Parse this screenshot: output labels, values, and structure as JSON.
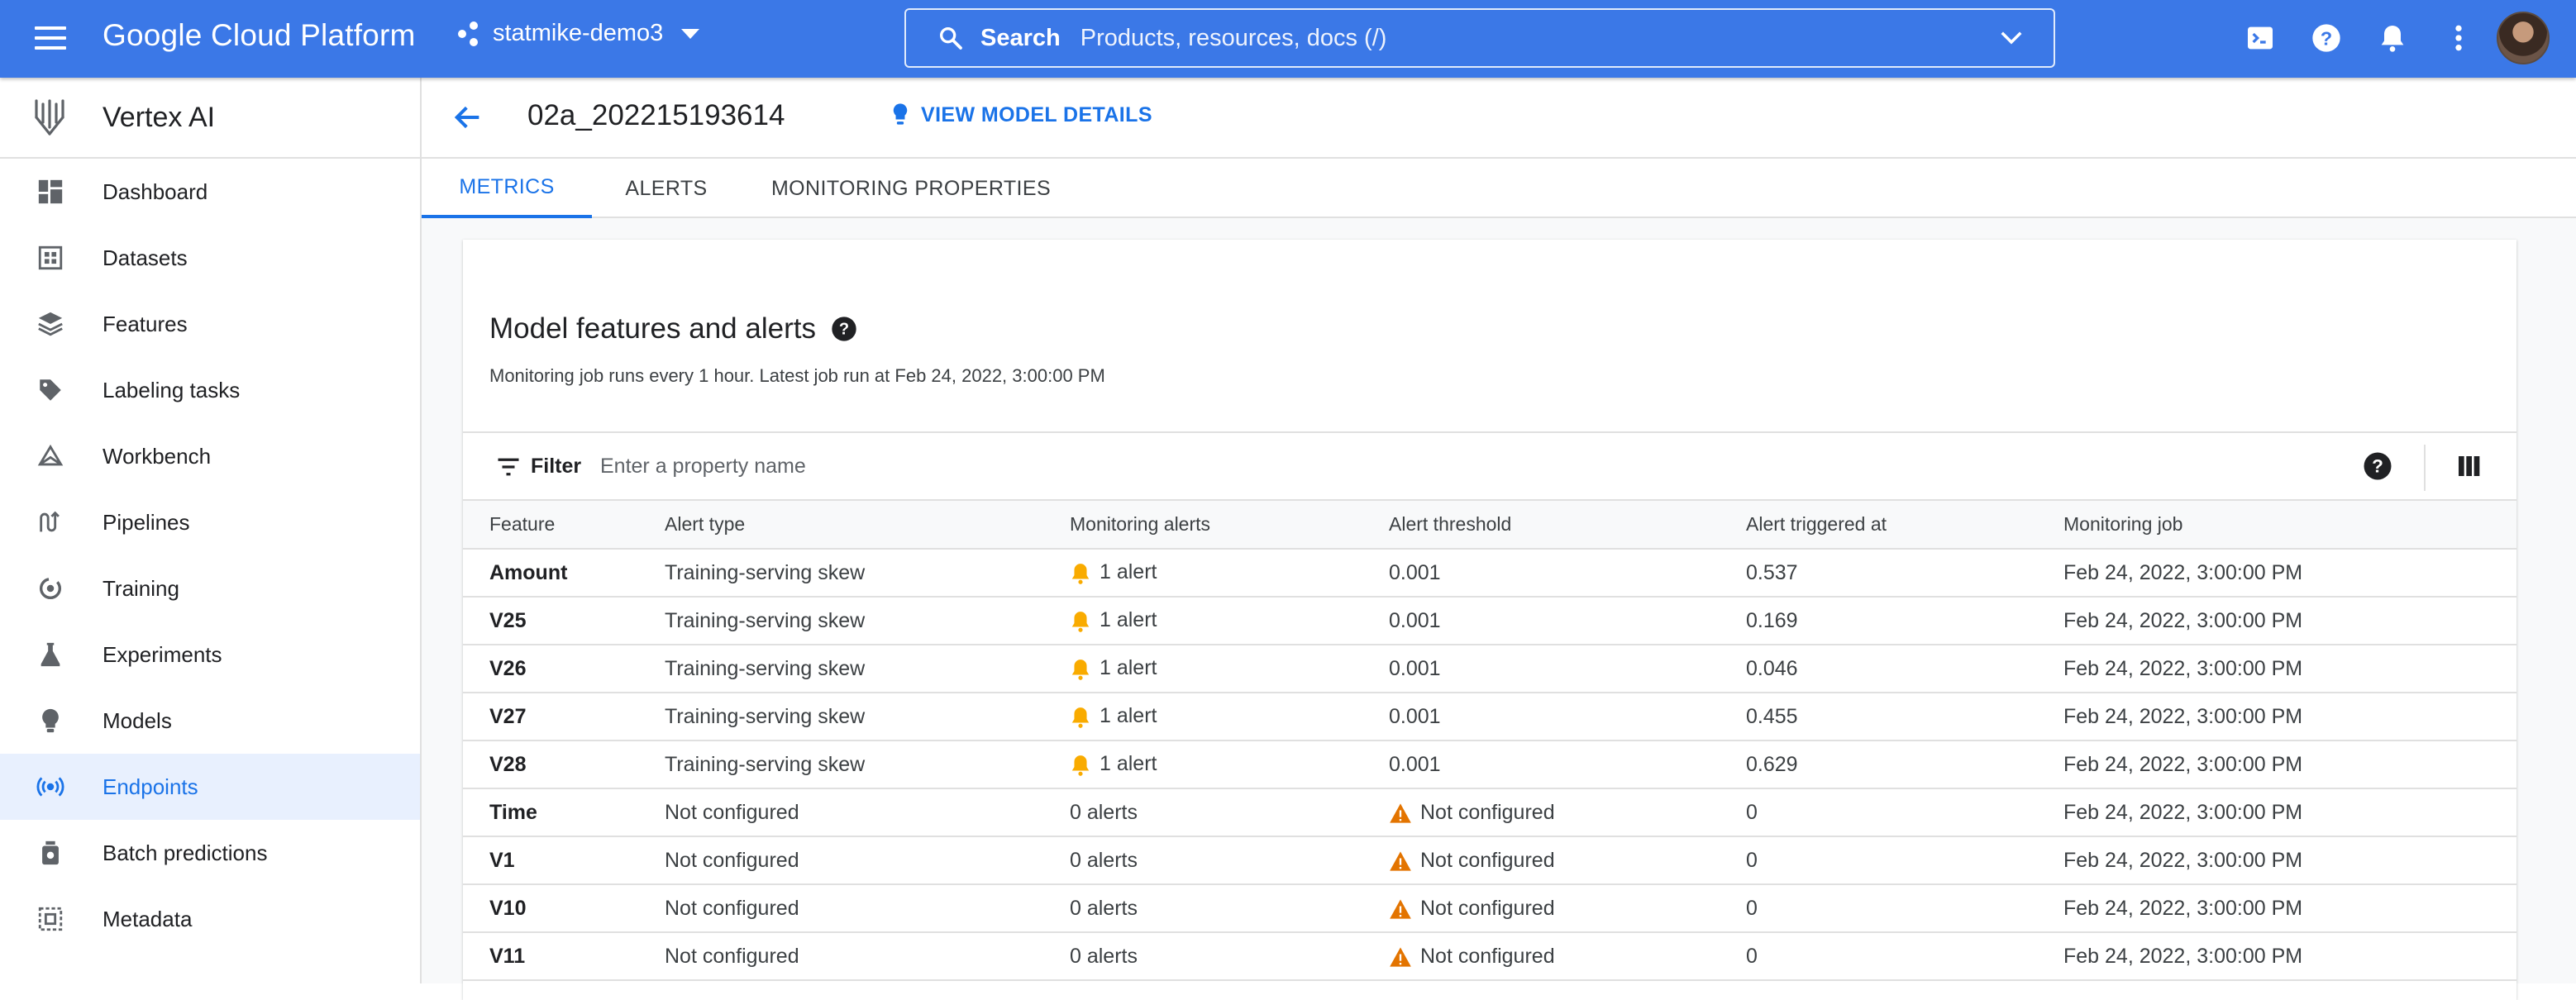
{
  "topbar": {
    "brand": "Google Cloud Platform",
    "project": "statmike-demo3",
    "search_label": "Search",
    "search_placeholder": "Products, resources, docs (/)"
  },
  "sidebar": {
    "title": "Vertex AI",
    "items": [
      {
        "label": "Dashboard",
        "icon": "dashboard-icon"
      },
      {
        "label": "Datasets",
        "icon": "datasets-icon"
      },
      {
        "label": "Features",
        "icon": "features-icon"
      },
      {
        "label": "Labeling tasks",
        "icon": "label-icon"
      },
      {
        "label": "Workbench",
        "icon": "workbench-icon"
      },
      {
        "label": "Pipelines",
        "icon": "pipelines-icon"
      },
      {
        "label": "Training",
        "icon": "training-icon"
      },
      {
        "label": "Experiments",
        "icon": "experiments-icon"
      },
      {
        "label": "Models",
        "icon": "lightbulb-icon"
      },
      {
        "label": "Endpoints",
        "icon": "endpoints-icon",
        "active": true
      },
      {
        "label": "Batch predictions",
        "icon": "batch-icon"
      },
      {
        "label": "Metadata",
        "icon": "metadata-icon"
      }
    ]
  },
  "header": {
    "title": "02a_202215193614",
    "view_details": "VIEW MODEL DETAILS"
  },
  "tabs": [
    {
      "label": "METRICS",
      "active": true
    },
    {
      "label": "ALERTS"
    },
    {
      "label": "MONITORING PROPERTIES"
    }
  ],
  "card": {
    "title": "Model features and alerts",
    "subtitle": "Monitoring job runs every 1 hour. Latest job run at Feb 24, 2022, 3:00:00 PM",
    "filter_label": "Filter",
    "filter_placeholder": "Enter a property name"
  },
  "table": {
    "columns": [
      "Feature",
      "Alert type",
      "Monitoring alerts",
      "Alert threshold",
      "Alert triggered at",
      "Monitoring job"
    ],
    "rows": [
      {
        "feature": "Amount",
        "alert_type": "Training-serving skew",
        "alerts": "1 alert",
        "alert_icon": "bell",
        "threshold": "0.001",
        "threshold_icon": "",
        "triggered": "0.537",
        "job": "Feb 24, 2022, 3:00:00 PM"
      },
      {
        "feature": "V25",
        "alert_type": "Training-serving skew",
        "alerts": "1 alert",
        "alert_icon": "bell",
        "threshold": "0.001",
        "threshold_icon": "",
        "triggered": "0.169",
        "job": "Feb 24, 2022, 3:00:00 PM"
      },
      {
        "feature": "V26",
        "alert_type": "Training-serving skew",
        "alerts": "1 alert",
        "alert_icon": "bell",
        "threshold": "0.001",
        "threshold_icon": "",
        "triggered": "0.046",
        "job": "Feb 24, 2022, 3:00:00 PM"
      },
      {
        "feature": "V27",
        "alert_type": "Training-serving skew",
        "alerts": "1 alert",
        "alert_icon": "bell",
        "threshold": "0.001",
        "threshold_icon": "",
        "triggered": "0.455",
        "job": "Feb 24, 2022, 3:00:00 PM"
      },
      {
        "feature": "V28",
        "alert_type": "Training-serving skew",
        "alerts": "1 alert",
        "alert_icon": "bell",
        "threshold": "0.001",
        "threshold_icon": "",
        "triggered": "0.629",
        "job": "Feb 24, 2022, 3:00:00 PM"
      },
      {
        "feature": "Time",
        "alert_type": "Not configured",
        "alerts": "0 alerts",
        "alert_icon": "",
        "threshold": "Not configured",
        "threshold_icon": "warning",
        "triggered": "0",
        "job": "Feb 24, 2022, 3:00:00 PM"
      },
      {
        "feature": "V1",
        "alert_type": "Not configured",
        "alerts": "0 alerts",
        "alert_icon": "",
        "threshold": "Not configured",
        "threshold_icon": "warning",
        "triggered": "0",
        "job": "Feb 24, 2022, 3:00:00 PM"
      },
      {
        "feature": "V10",
        "alert_type": "Not configured",
        "alerts": "0 alerts",
        "alert_icon": "",
        "threshold": "Not configured",
        "threshold_icon": "warning",
        "triggered": "0",
        "job": "Feb 24, 2022, 3:00:00 PM"
      },
      {
        "feature": "V11",
        "alert_type": "Not configured",
        "alerts": "0 alerts",
        "alert_icon": "",
        "threshold": "Not configured",
        "threshold_icon": "warning",
        "triggered": "0",
        "job": "Feb 24, 2022, 3:00:00 PM"
      }
    ]
  },
  "colors": {
    "topbar": "#3b78e7",
    "accent": "#1a73e8",
    "bell": "#f9ab00",
    "warning": "#e37400"
  }
}
